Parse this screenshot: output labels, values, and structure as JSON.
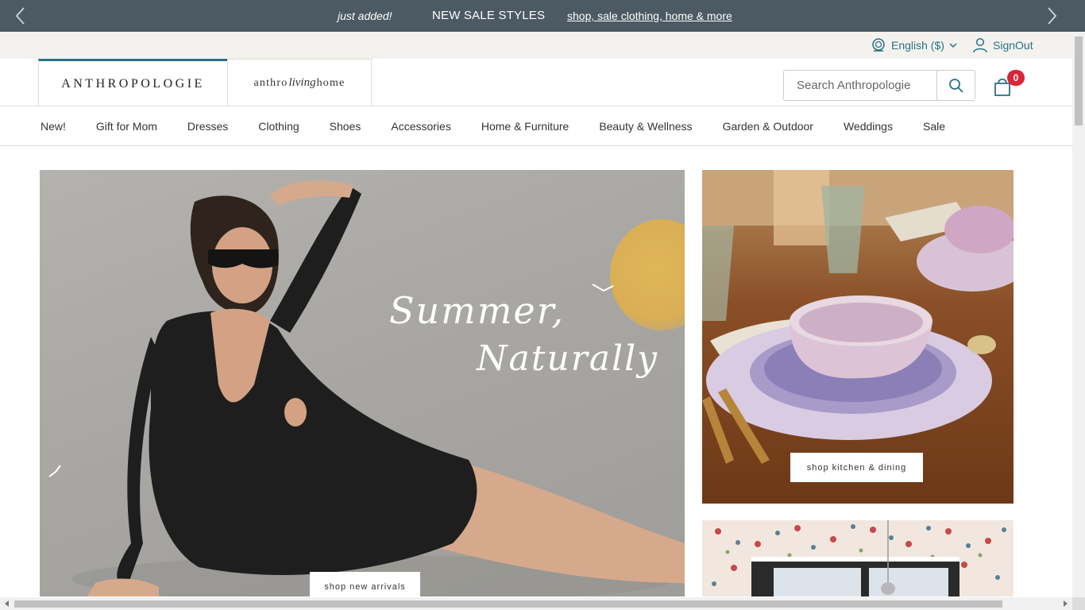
{
  "promo": {
    "tag": "just added!",
    "headline": "NEW SALE STYLES",
    "link": "shop, sale clothing, home & more"
  },
  "utility": {
    "language": "English ($)",
    "signout": "SignOut"
  },
  "brands": {
    "main": "ANTHROPOLOGIE",
    "home_prefix": "anthro",
    "home_script": "living",
    "home_suffix": "home"
  },
  "search": {
    "placeholder": "Search Anthropologie"
  },
  "cart": {
    "count": "0"
  },
  "nav": {
    "items": [
      "New!",
      "Gift for Mom",
      "Dresses",
      "Clothing",
      "Shoes",
      "Accessories",
      "Home & Furniture",
      "Beauty & Wellness",
      "Garden & Outdoor",
      "Weddings",
      "Sale"
    ]
  },
  "hero": {
    "script_line1": "Summer,",
    "script_line2": "Naturally",
    "cta": "shop new arrivals"
  },
  "side1": {
    "cta": "shop kitchen & dining"
  },
  "colors": {
    "promo_bg": "#4b5a63",
    "accent": "#2a7186",
    "badge": "#d72638"
  }
}
